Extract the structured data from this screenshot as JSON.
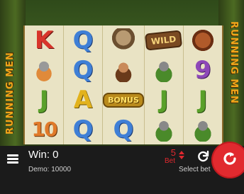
{
  "game": {
    "side_text_left": "RUNNING MEN",
    "side_text_right": "RUNNING MEN"
  },
  "reels": [
    [
      "K",
      "caveman-helmet",
      "J",
      "10"
    ],
    [
      "Q",
      "Q",
      "A",
      "Q"
    ],
    [
      "goat",
      "caveman-beard",
      "BONUS",
      "Q"
    ],
    [
      "WILD",
      "caveman-green",
      "J",
      "caveman-green"
    ],
    [
      "mammoth",
      "9",
      "J",
      "caveman-green"
    ]
  ],
  "bottom_bar": {
    "menu_icon": "hamburger-menu-icon",
    "win_label": "Win: 0",
    "demo_label": "Demo: 10000",
    "bet_value": "5",
    "bet_label": "Bet",
    "select_bet_label": "Select bet",
    "autoplay_icon": "refresh-icon",
    "spin_icon": "spin-arrow-icon"
  },
  "colors": {
    "accent": "#e12a2f",
    "bar": "#1b1b1b",
    "reel_bg": "#e9e3c4"
  }
}
